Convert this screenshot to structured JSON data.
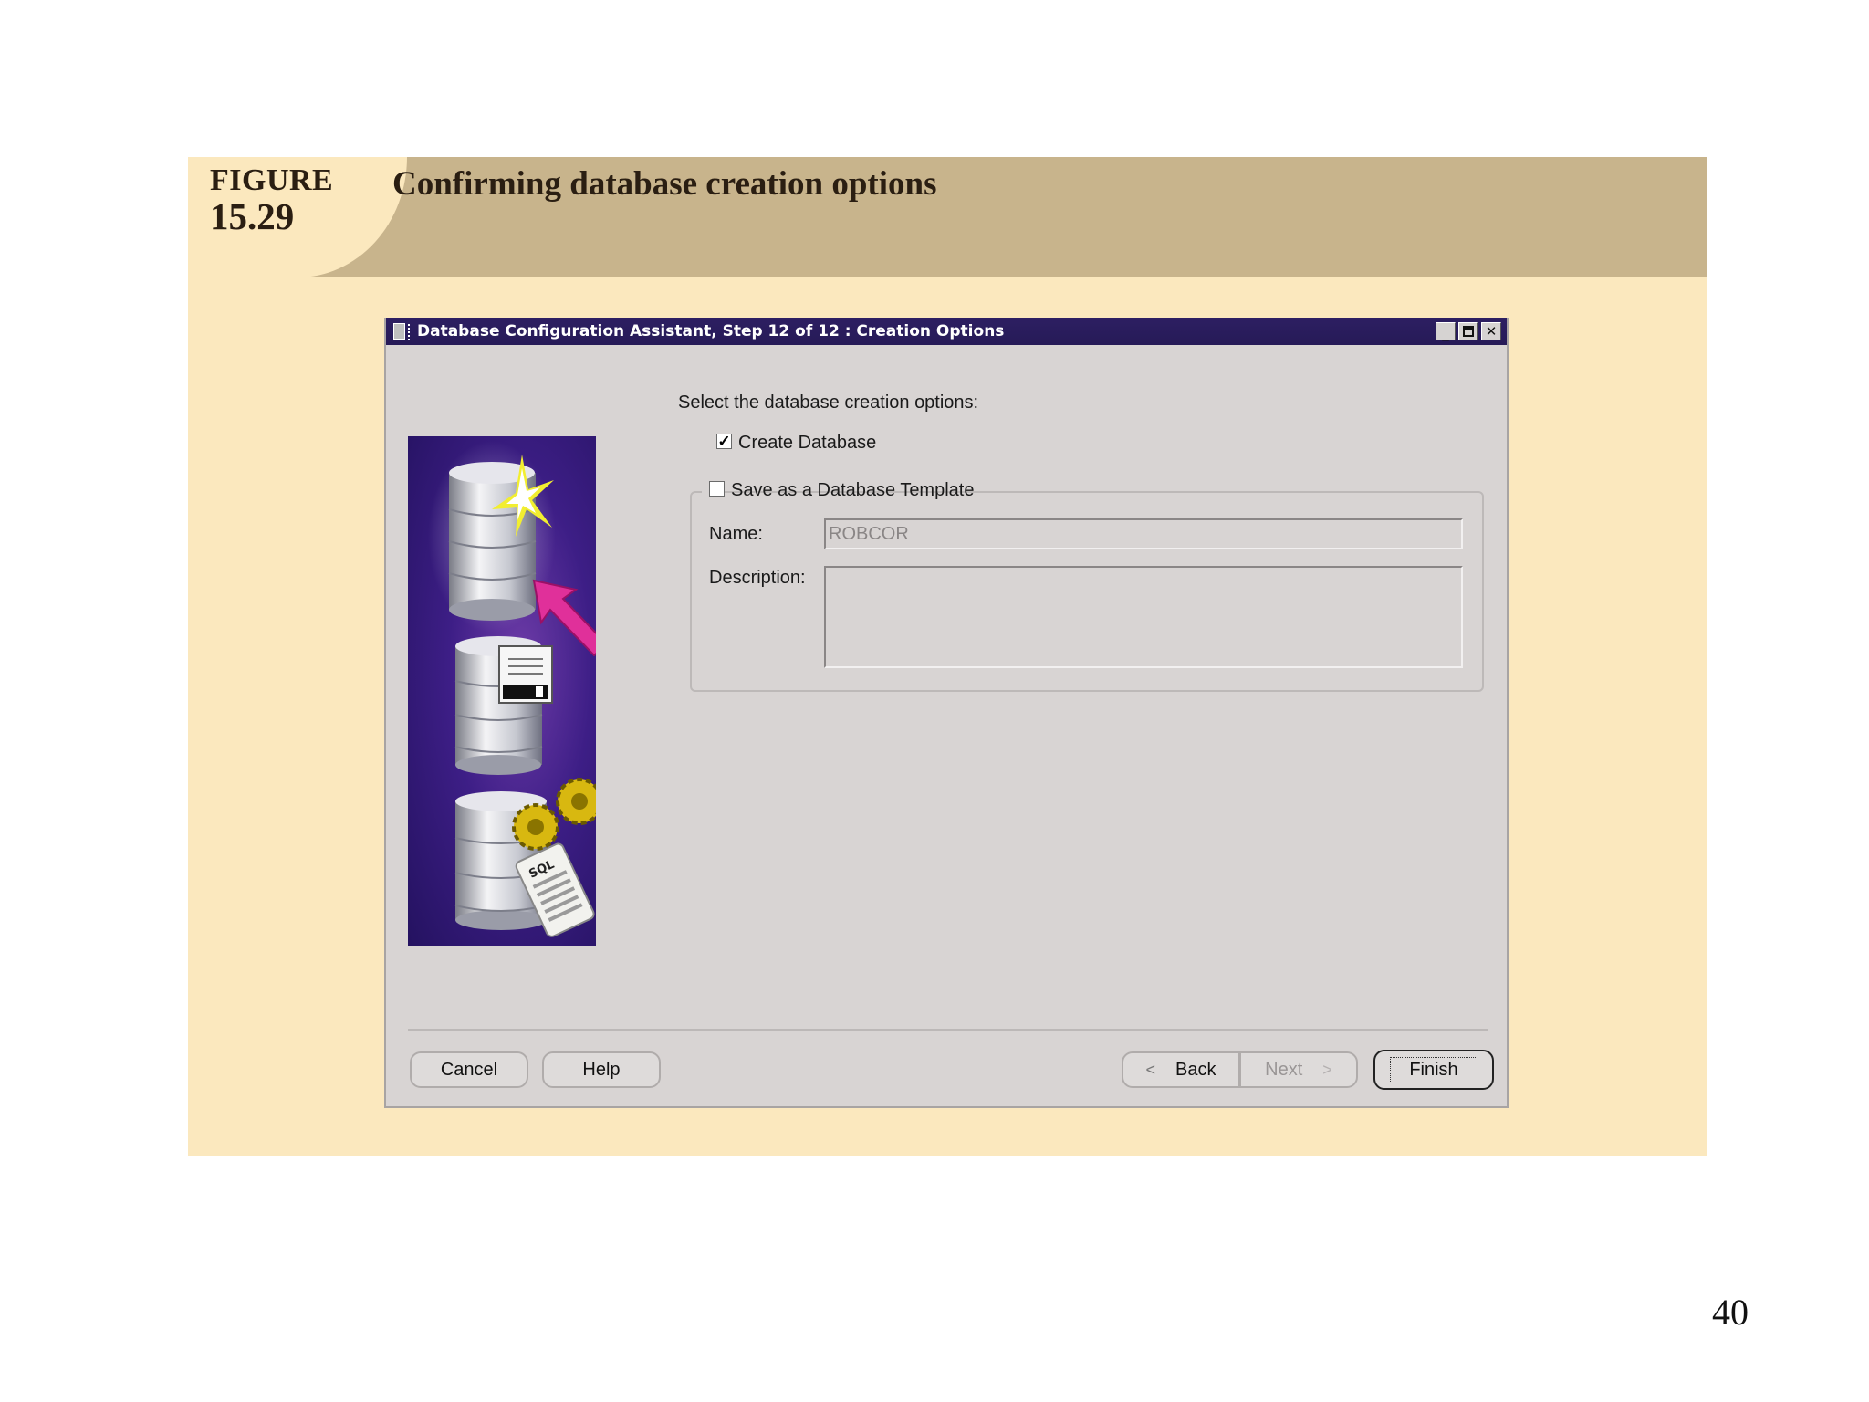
{
  "figure": {
    "label_word": "FIGURE",
    "label_number": "15.29",
    "title": "Confirming database creation options"
  },
  "dialog": {
    "title": "Database Configuration Assistant, Step 12 of 12 : Creation Options",
    "controls": [
      "minimize",
      "maximize",
      "close"
    ],
    "prompt": "Select the database creation options:",
    "create_database": {
      "label": "Create Database",
      "checked": true
    },
    "save_template": {
      "label": "Save as a Database Template",
      "checked": false
    },
    "name_label": "Name:",
    "name_value": "ROBCOR",
    "description_label": "Description:",
    "description_value": "",
    "buttons": {
      "cancel": "Cancel",
      "help": "Help",
      "back": "Back",
      "next": "Next",
      "finish": "Finish"
    }
  },
  "icons": [
    "database-star-icon",
    "database-floppy-icon",
    "database-gears-sql-icon",
    "magenta-arrow-icon"
  ],
  "colors": {
    "titlebar": "#2d1f62",
    "panel_bg": "#fbe8be",
    "header_bg": "#c8b48c",
    "dialog_bg": "#d8d4d3",
    "illustration_bg": "#3d1e86",
    "arrow": "#e0309a"
  },
  "page_number": "40"
}
